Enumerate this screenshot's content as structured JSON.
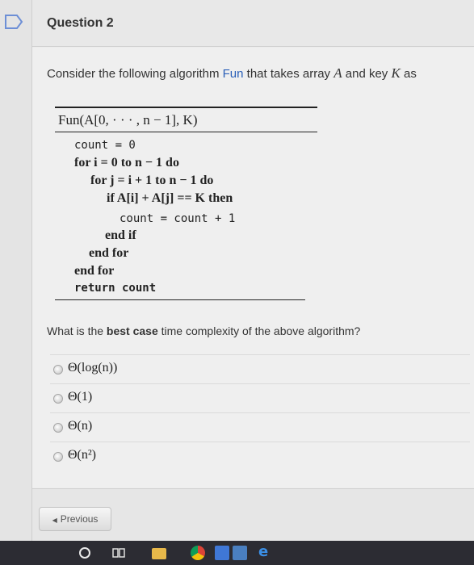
{
  "question": {
    "title": "Question 2",
    "prompt_pre": "Consider the following algorithm ",
    "prompt_fun": "Fun",
    "prompt_mid": " that takes array ",
    "prompt_a": "A",
    "prompt_mid2": " and key ",
    "prompt_k": "K",
    "prompt_post": " as"
  },
  "algorithm": {
    "header": "Fun(A[0, · · · , n − 1], K)",
    "lines": [
      "count = 0",
      "for i = 0 to n − 1 do",
      "for j = i + 1 to n − 1 do",
      "if A[i] + A[j] == K then",
      "count = count + 1",
      "end if",
      "end for",
      "end for",
      "return count"
    ]
  },
  "question2": {
    "pre": "What is the ",
    "bold": "best case",
    "post": " time complexity of the above algorithm?"
  },
  "options": [
    "Θ(log(n))",
    "Θ(1)",
    "Θ(n)",
    "Θ(n²)"
  ],
  "nav": {
    "previous_label": "Previous"
  },
  "taskbar": {
    "edge_glyph": "e"
  },
  "colors": {
    "link_blue": "#2a5fb8",
    "flag_blue": "#6d8fd6",
    "taskbar": "#2c2c33"
  }
}
